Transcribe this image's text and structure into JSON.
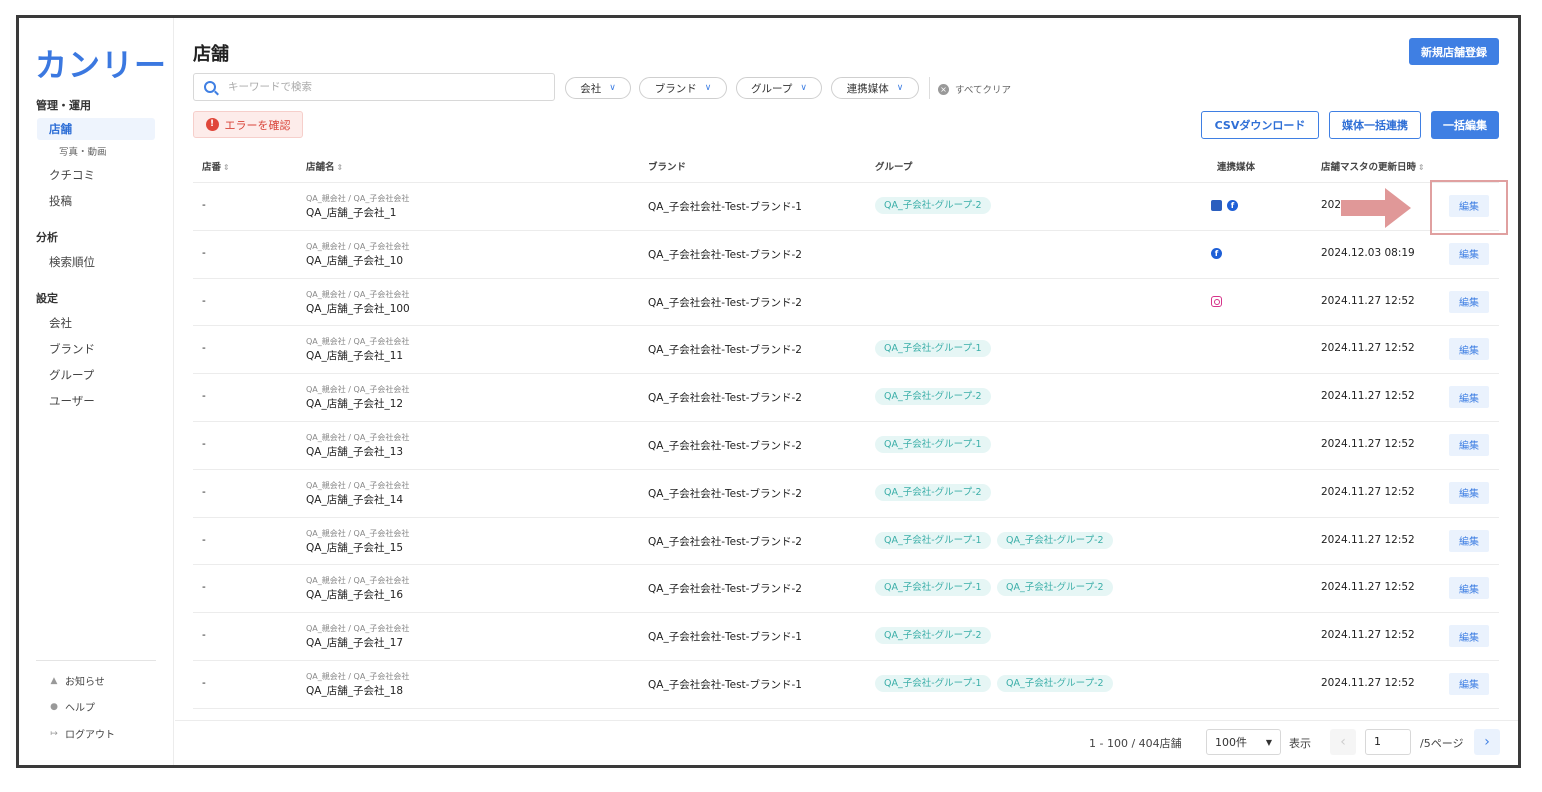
{
  "app": {
    "logo": "カンリー"
  },
  "sidebar": {
    "sections": [
      {
        "heading": "管理・運用"
      },
      {
        "heading": "分析"
      },
      {
        "heading": "設定"
      }
    ],
    "items": {
      "stores": "店舗",
      "photos": "写真・動画",
      "reviews": "クチコミ",
      "posts": "投稿",
      "search_rank": "検索順位",
      "company": "会社",
      "brand": "ブランド",
      "group": "グループ",
      "users": "ユーザー"
    },
    "footer": {
      "notifications": "お知らせ",
      "help": "ヘルプ",
      "logout": "ログアウト"
    }
  },
  "header": {
    "title": "店舗",
    "new_store_button": "新規店舗登録",
    "search_placeholder": "キーワードで検索",
    "filters": [
      "会社",
      "ブランド",
      "グループ",
      "連携媒体"
    ],
    "clear_all": "すべてクリア",
    "error_button": "エラーを確認",
    "csv_button": "CSVダウンロード",
    "media_link_button": "媒体一括連携",
    "bulk_edit_button": "一括編集"
  },
  "table": {
    "columns": {
      "store_no": "店番",
      "store_name": "店舗名",
      "brand": "ブランド",
      "group": "グループ",
      "media": "連携媒体",
      "updated": "店舗マスタの更新日時"
    },
    "edit_label": "編集",
    "rows": [
      {
        "no": "-",
        "company": "QA_親会社 / QA_子会社会社",
        "name": "QA_店舗_子会社_1",
        "brand": "QA_子会社会社-Test-ブランド-1",
        "groups": [
          "QA_子会社-グループ-2"
        ],
        "media": [
          "google-business-icon",
          "facebook-icon"
        ],
        "updated": "2024"
      },
      {
        "no": "-",
        "company": "QA_親会社 / QA_子会社会社",
        "name": "QA_店舗_子会社_10",
        "brand": "QA_子会社会社-Test-ブランド-2",
        "groups": [],
        "media": [
          "facebook-icon"
        ],
        "updated": "2024.12.03 08:19"
      },
      {
        "no": "-",
        "company": "QA_親会社 / QA_子会社会社",
        "name": "QA_店舗_子会社_100",
        "brand": "QA_子会社会社-Test-ブランド-2",
        "groups": [],
        "media": [
          "instagram-icon"
        ],
        "updated": "2024.11.27 12:52"
      },
      {
        "no": "-",
        "company": "QA_親会社 / QA_子会社会社",
        "name": "QA_店舗_子会社_11",
        "brand": "QA_子会社会社-Test-ブランド-2",
        "groups": [
          "QA_子会社-グループ-1"
        ],
        "media": [],
        "updated": "2024.11.27 12:52"
      },
      {
        "no": "-",
        "company": "QA_親会社 / QA_子会社会社",
        "name": "QA_店舗_子会社_12",
        "brand": "QA_子会社会社-Test-ブランド-2",
        "groups": [
          "QA_子会社-グループ-2"
        ],
        "media": [],
        "updated": "2024.11.27 12:52"
      },
      {
        "no": "-",
        "company": "QA_親会社 / QA_子会社会社",
        "name": "QA_店舗_子会社_13",
        "brand": "QA_子会社会社-Test-ブランド-2",
        "groups": [
          "QA_子会社-グループ-1"
        ],
        "media": [],
        "updated": "2024.11.27 12:52"
      },
      {
        "no": "-",
        "company": "QA_親会社 / QA_子会社会社",
        "name": "QA_店舗_子会社_14",
        "brand": "QA_子会社会社-Test-ブランド-2",
        "groups": [
          "QA_子会社-グループ-2"
        ],
        "media": [],
        "updated": "2024.11.27 12:52"
      },
      {
        "no": "-",
        "company": "QA_親会社 / QA_子会社会社",
        "name": "QA_店舗_子会社_15",
        "brand": "QA_子会社会社-Test-ブランド-2",
        "groups": [
          "QA_子会社-グループ-1",
          "QA_子会社-グループ-2"
        ],
        "media": [],
        "updated": "2024.11.27 12:52"
      },
      {
        "no": "-",
        "company": "QA_親会社 / QA_子会社会社",
        "name": "QA_店舗_子会社_16",
        "brand": "QA_子会社会社-Test-ブランド-2",
        "groups": [
          "QA_子会社-グループ-1",
          "QA_子会社-グループ-2"
        ],
        "media": [],
        "updated": "2024.11.27 12:52"
      },
      {
        "no": "-",
        "company": "QA_親会社 / QA_子会社会社",
        "name": "QA_店舗_子会社_17",
        "brand": "QA_子会社会社-Test-ブランド-1",
        "groups": [
          "QA_子会社-グループ-2"
        ],
        "media": [],
        "updated": "2024.11.27 12:52"
      },
      {
        "no": "-",
        "company": "QA_親会社 / QA_子会社会社",
        "name": "QA_店舗_子会社_18",
        "brand": "QA_子会社会社-Test-ブランド-1",
        "groups": [
          "QA_子会社-グループ-1",
          "QA_子会社-グループ-2"
        ],
        "media": [],
        "updated": "2024.11.27 12:52"
      }
    ]
  },
  "pagination": {
    "range": "1 - 100 / 404店舗",
    "per_page": "100件",
    "display_label": "表示",
    "current_page": "1",
    "total_pages": "/5ページ"
  },
  "colors": {
    "accent": "#3f7fe3",
    "tag_bg": "#e6f6f5",
    "tag_text": "#3aaea8",
    "error": "#d9453a",
    "highlight": "#e0a0a0"
  }
}
